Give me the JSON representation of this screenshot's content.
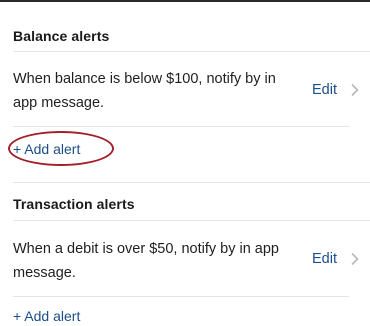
{
  "balance_section": {
    "header": "Balance alerts",
    "alert": {
      "text": "When balance is below $100, notify by in app message.",
      "edit_label": "Edit"
    },
    "add_alert_label": "+ Add alert"
  },
  "transaction_section": {
    "header": "Transaction alerts",
    "alert": {
      "text": "When a debit is over $50, notify by in app message.",
      "edit_label": "Edit"
    },
    "add_alert_label": "+ Add alert"
  },
  "colors": {
    "link": "#1b4e8c",
    "highlight": "#a2202a",
    "chevron": "#b8b8b8"
  },
  "icons": {
    "edit_chevron": "chevron-right-icon"
  }
}
